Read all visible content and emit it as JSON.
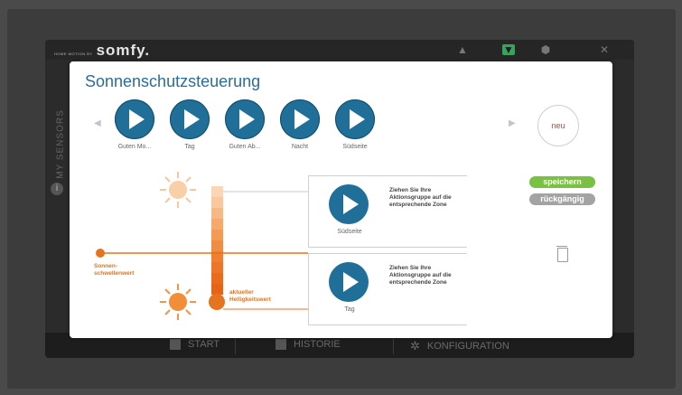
{
  "brand": {
    "small": "HOME MOTION BY",
    "logo": "somfy."
  },
  "side_label": "MY SENSORS",
  "bottom_bar": {
    "items": [
      "START",
      "HISTORIE",
      "KONFIGURATION"
    ]
  },
  "dialog": {
    "title": "Sonnenschutzsteuerung",
    "scenes": [
      "Guten Mo...",
      "Tag",
      "Guten Ab...",
      "Nacht",
      "Südseite"
    ],
    "new_button": "neu",
    "zones": [
      {
        "label": "Südseite",
        "hint": "Ziehen Sie Ihre Aktionsgruppe auf die entsprechende Zone"
      },
      {
        "label": "Tag",
        "hint": "Ziehen Sie Ihre Aktionsgruppe auf die entsprechende Zone"
      }
    ],
    "save_label": "speichern",
    "undo_label": "rückgängig",
    "threshold_label": "Sonnen-\nschwellenwert",
    "current_label": "aktueller\nHelligkeitswert"
  },
  "colors": {
    "accent": "#1f6f99",
    "title": "#2a6d9c",
    "orange": "#e4741e",
    "save": "#7ac143",
    "undo": "#a3a3a3"
  }
}
